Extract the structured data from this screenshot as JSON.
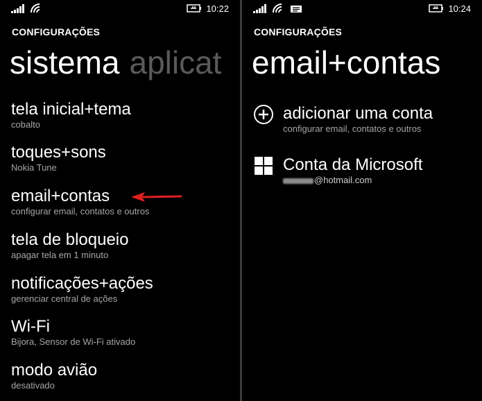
{
  "left": {
    "status_time": "10:22",
    "app_title": "CONFIGURAÇÕES",
    "pivot": {
      "active": "sistema",
      "inactive": "aplicat"
    },
    "items": [
      {
        "title": "tela inicial+tema",
        "subtitle": "cobalto"
      },
      {
        "title": "toques+sons",
        "subtitle": "Nokia Tune"
      },
      {
        "title": "email+contas",
        "subtitle": "configurar email, contatos e outros"
      },
      {
        "title": "tela de bloqueio",
        "subtitle": "apagar tela em 1 minuto"
      },
      {
        "title": "notificações+ações",
        "subtitle": "gerenciar central de ações"
      },
      {
        "title": "Wi-Fi",
        "subtitle": "Bijora, Sensor de Wi-Fi ativado"
      },
      {
        "title": "modo avião",
        "subtitle": "desativado"
      }
    ],
    "annotation_color": "#e02020"
  },
  "right": {
    "status_time": "10:24",
    "app_title": "CONFIGURAÇÕES",
    "page_title": "email+contas",
    "add_account": {
      "title": "adicionar uma conta",
      "subtitle": "configurar email, contatos e outros",
      "icon": "plus-circle-icon"
    },
    "microsoft_account": {
      "title": "Conta da Microsoft",
      "email_suffix": "@hotmail.com",
      "icon": "windows-logo-icon"
    }
  }
}
